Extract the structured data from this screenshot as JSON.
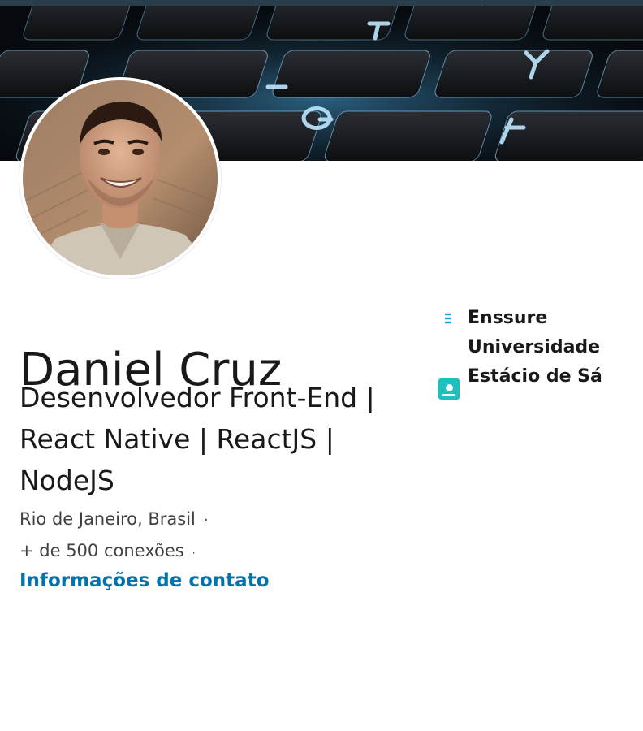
{
  "profile": {
    "name": "Daniel Cruz",
    "headline": "Desenvolvedor Front-End | React Native | ReactJS | NodeJS",
    "location": "Rio de Janeiro, Brasil",
    "connections": "+ de 500 conexões",
    "contact_link": "Informações de contato",
    "separator": "·"
  },
  "experience": [
    {
      "name": "Enssure",
      "logo": "enssure-logo-icon"
    },
    {
      "name": "Universidade Estácio de Sá",
      "logo": "estacio-logo-icon"
    }
  ],
  "colors": {
    "link": "#0073b1",
    "top_bar": "#283e4a",
    "estacio_brand": "#1fbfc0",
    "keyboard_glow": "#8fd4ff"
  }
}
